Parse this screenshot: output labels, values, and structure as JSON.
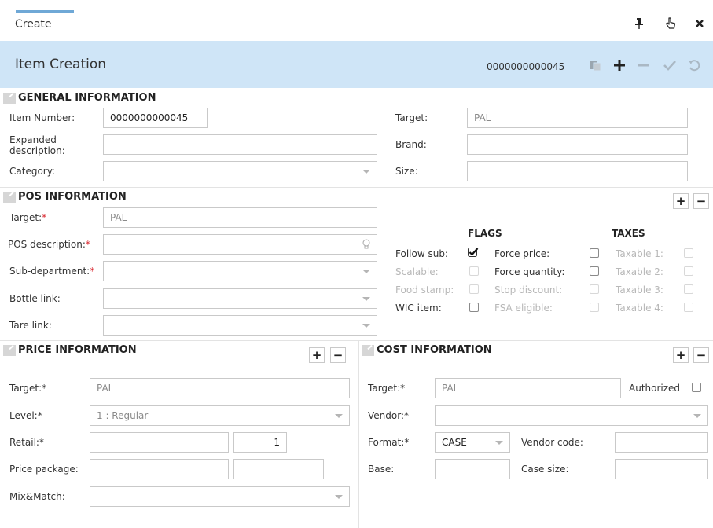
{
  "tab": {
    "label": "Create"
  },
  "window_buttons": {
    "pin": "pin-icon",
    "pointer": "pointer-icon",
    "close": "close-icon"
  },
  "header": {
    "title": "Item Creation",
    "item_id": "0000000000045",
    "icons": [
      "copy-icon",
      "plus-icon",
      "minus-icon",
      "check-icon",
      "undo-icon"
    ]
  },
  "general": {
    "title": "GENERAL INFORMATION",
    "item_number_label": "Item Number:",
    "item_number_value": "0000000000045",
    "expanded_desc_label_1": "Expanded",
    "expanded_desc_label_2": "description:",
    "category_label": "Category:",
    "target_label": "Target:",
    "target_value": "PAL",
    "brand_label": "Brand:",
    "size_label": "Size:"
  },
  "pos": {
    "title": "POS INFORMATION",
    "target_label": "Target:",
    "target_value": "PAL",
    "pos_desc_label": "POS description:",
    "subdept_label": "Sub-department:",
    "bottle_link_label": "Bottle link:",
    "tare_link_label": "Tare link:",
    "flags_header": "FLAGS",
    "taxes_header": "TAXES",
    "follow_sub": "Follow sub:",
    "scalable": "Scalable:",
    "food_stamp": "Food stamp:",
    "wic_item": "WIC item:",
    "force_price": "Force price:",
    "force_quantity": "Force quantity:",
    "stop_discount": "Stop discount:",
    "fsa_eligible": "FSA eligible:",
    "taxable_1": "Taxable 1:",
    "taxable_2": "Taxable 2:",
    "taxable_3": "Taxable 3:",
    "taxable_4": "Taxable 4:",
    "follow_sub_checked": true
  },
  "price": {
    "title": "PRICE INFORMATION",
    "target_label": "Target:*",
    "target_value": "PAL",
    "level_label": "Level:*",
    "level_value": "1 : Regular",
    "retail_label": "Retail:*",
    "retail_qty": "1",
    "price_package_label": "Price package:",
    "mix_match_label": "Mix&Match:"
  },
  "cost": {
    "title": "COST INFORMATION",
    "target_label": "Target:*",
    "target_value": "PAL",
    "authorized_label": "Authorized",
    "vendor_label": "Vendor:*",
    "format_label": "Format:*",
    "format_value": "CASE",
    "vendor_code_label": "Vendor code:",
    "base_label": "Base:",
    "case_size_label": "Case size:"
  },
  "buttons": {
    "plus": "+",
    "minus": "−"
  },
  "colors": {
    "header_band": "#cfe5f7",
    "tab_accent": "#6fa8d6",
    "required": "#d9262e"
  }
}
